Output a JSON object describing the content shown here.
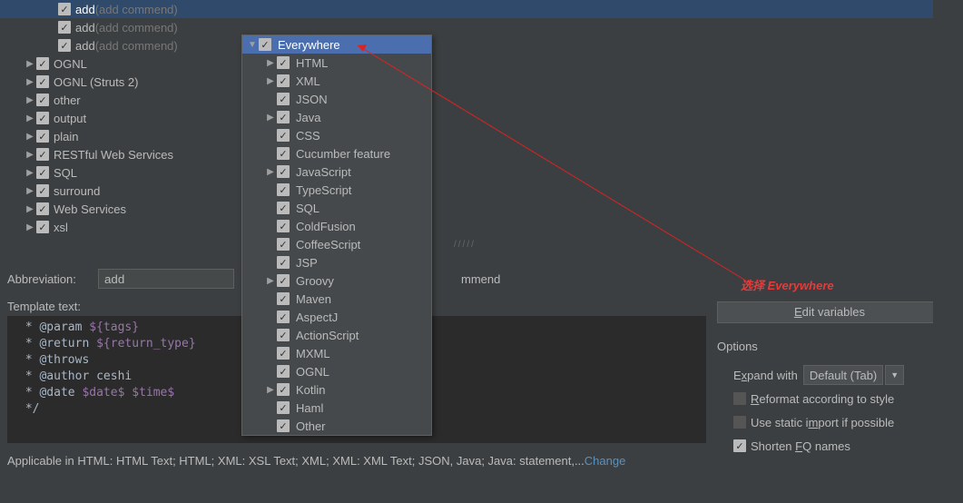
{
  "tree": {
    "items": [
      {
        "level": 2,
        "arrow": "blank",
        "label": "add",
        "desc": " (add commend)",
        "highlight": true
      },
      {
        "level": 2,
        "arrow": "blank",
        "label": "add",
        "desc": " (add commend)"
      },
      {
        "level": 2,
        "arrow": "blank",
        "label": "add",
        "desc": " (add commend)"
      },
      {
        "level": 1,
        "arrow": "r",
        "label": "OGNL"
      },
      {
        "level": 1,
        "arrow": "r",
        "label": "OGNL (Struts 2)"
      },
      {
        "level": 1,
        "arrow": "r",
        "label": "other"
      },
      {
        "level": 1,
        "arrow": "r",
        "label": "output"
      },
      {
        "level": 1,
        "arrow": "r",
        "label": "plain"
      },
      {
        "level": 1,
        "arrow": "r",
        "label": "RESTful Web Services"
      },
      {
        "level": 1,
        "arrow": "r",
        "label": "SQL"
      },
      {
        "level": 1,
        "arrow": "r",
        "label": "surround"
      },
      {
        "level": 1,
        "arrow": "r",
        "label": "Web Services"
      },
      {
        "level": 1,
        "arrow": "r",
        "label": "xsl"
      }
    ]
  },
  "form": {
    "abbrev_label": "Abbreviation:",
    "abbrev_value": "add",
    "desc_fragment": "mmend",
    "template_text_label": "Template text:"
  },
  "editor": {
    "line1_a": " * @param ",
    "line1_b": "${tags}",
    "line2_a": " * @return ",
    "line2_b": "${return_type}",
    "line3": " * @throws",
    "line4": " * @author ceshi",
    "line5_a": " * @date ",
    "line5_b": "$date$",
    "line5_c": " ",
    "line5_d": "$time$",
    "line6": " */"
  },
  "right": {
    "edit_vars": "Edit variables",
    "options_title": "Options",
    "expand_with": "Expand with",
    "expand_value": "Default (Tab)",
    "reformat": "Reformat according to style",
    "static_import": "Use static import if possible",
    "shorten_fq": "Shorten FQ names"
  },
  "applicable": {
    "text": "Applicable in HTML: HTML Text; HTML; XML: XSL Text; XML; XML: XML Text; JSON, Java; Java: statement,...",
    "change": "Change"
  },
  "popup": {
    "items": [
      {
        "label": "Everywhere",
        "arrow": "v",
        "selected": true
      },
      {
        "label": "HTML",
        "arrow": "r"
      },
      {
        "label": "XML",
        "arrow": "r"
      },
      {
        "label": "JSON",
        "arrow": "blank"
      },
      {
        "label": "Java",
        "arrow": "r"
      },
      {
        "label": "CSS",
        "arrow": "blank"
      },
      {
        "label": "Cucumber feature",
        "arrow": "blank"
      },
      {
        "label": "JavaScript",
        "arrow": "r"
      },
      {
        "label": "TypeScript",
        "arrow": "blank"
      },
      {
        "label": "SQL",
        "arrow": "blank"
      },
      {
        "label": "ColdFusion",
        "arrow": "blank"
      },
      {
        "label": "CoffeeScript",
        "arrow": "blank"
      },
      {
        "label": "JSP",
        "arrow": "blank"
      },
      {
        "label": "Groovy",
        "arrow": "r"
      },
      {
        "label": "Maven",
        "arrow": "blank"
      },
      {
        "label": "AspectJ",
        "arrow": "blank"
      },
      {
        "label": "ActionScript",
        "arrow": "blank"
      },
      {
        "label": "MXML",
        "arrow": "blank"
      },
      {
        "label": "OGNL",
        "arrow": "blank"
      },
      {
        "label": "Kotlin",
        "arrow": "r"
      },
      {
        "label": "Haml",
        "arrow": "blank"
      },
      {
        "label": "Other",
        "arrow": "blank"
      }
    ]
  },
  "annotation": {
    "red_text": "选择 Everywhere"
  }
}
